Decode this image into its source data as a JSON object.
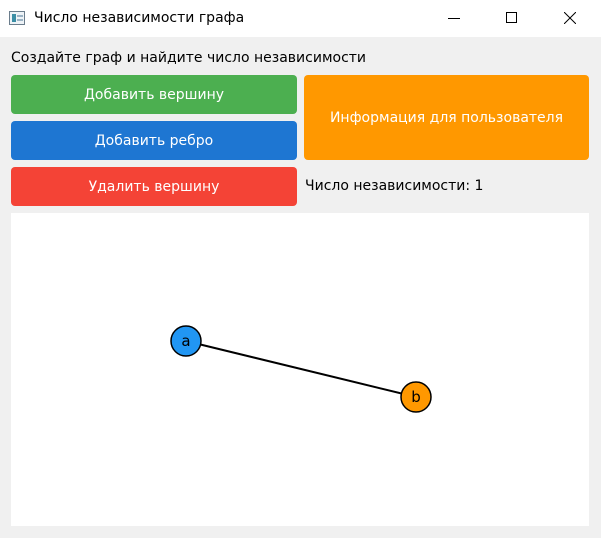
{
  "window": {
    "title": "Число независимости графа"
  },
  "app": {
    "prompt": "Создайте граф и найдите число независимости",
    "buttons": {
      "add_vertex": "Добавить вершину",
      "add_edge": "Добавить ребро",
      "delete_vertex": "Удалить вершину",
      "info": "Информация для пользователя"
    },
    "result_label": "Число независимости: 1"
  },
  "graph": {
    "nodes": [
      {
        "id": "a",
        "label": "a",
        "color": "#2196f3"
      },
      {
        "id": "b",
        "label": "b",
        "color": "#ff9800"
      }
    ],
    "edges": [
      {
        "from": "a",
        "to": "b"
      }
    ]
  },
  "colors": {
    "add_vertex": "#4caf50",
    "add_edge": "#1e76d2",
    "delete_vertex": "#f44336",
    "info": "#ff9800"
  }
}
